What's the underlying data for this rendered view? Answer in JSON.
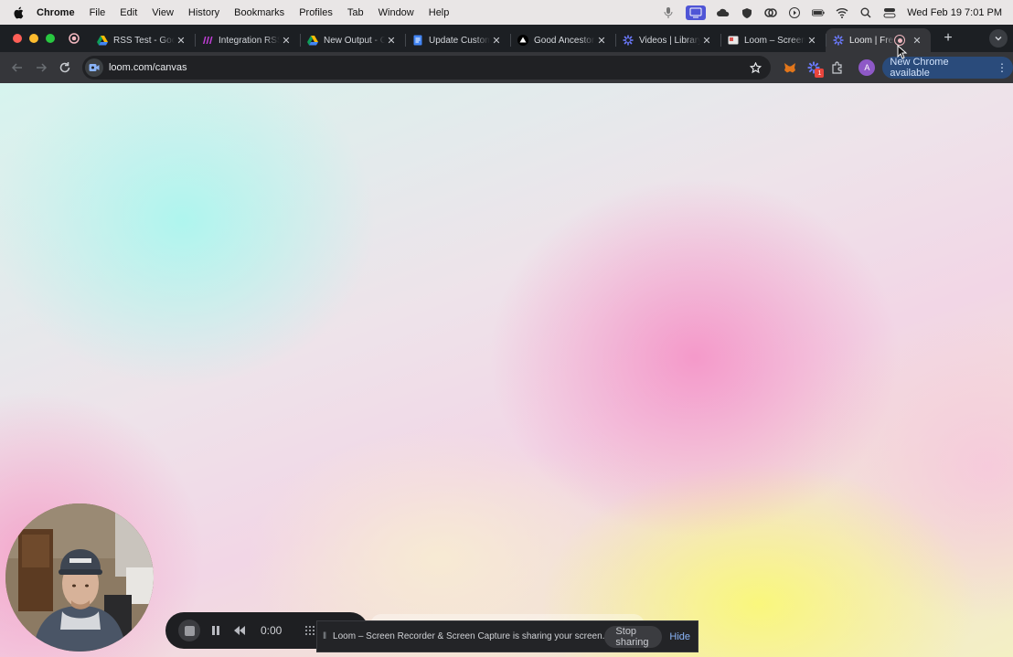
{
  "menubar": {
    "app_name": "Chrome",
    "items": [
      "File",
      "Edit",
      "View",
      "History",
      "Bookmarks",
      "Profiles",
      "Tab",
      "Window",
      "Help"
    ],
    "clock": "Wed Feb 19  7:01 PM"
  },
  "tabs": [
    {
      "title": "RSS Test - Google",
      "icon": "google-drive-icon"
    },
    {
      "title": "Integration RSS",
      "icon": "make-icon"
    },
    {
      "title": "New Output - Google",
      "icon": "google-drive-icon"
    },
    {
      "title": "Update Customer",
      "icon": "google-docs-icon"
    },
    {
      "title": "Good Ancestor",
      "icon": "triangle-icon"
    },
    {
      "title": "Videos | Library",
      "icon": "loom-icon"
    },
    {
      "title": "Loom – Screen Recorder",
      "icon": "loom-screen-icon"
    },
    {
      "title": "Loom | Free",
      "icon": "loom-icon",
      "active": true
    }
  ],
  "toolbar": {
    "url": "loom.com/canvas",
    "update_label": "New Chrome available",
    "profile_initial": "A",
    "extension_badge": "1"
  },
  "recorder": {
    "timer": "0:00"
  },
  "share_bar": {
    "message": "Loom – Screen Recorder & Screen Capture is sharing your screen.",
    "stop_label": "Stop sharing",
    "hide_label": "Hide"
  },
  "colors": {
    "accent": "#8ab4f8",
    "update_pill": "#2a4b7b",
    "profile": "#8e59c7"
  }
}
